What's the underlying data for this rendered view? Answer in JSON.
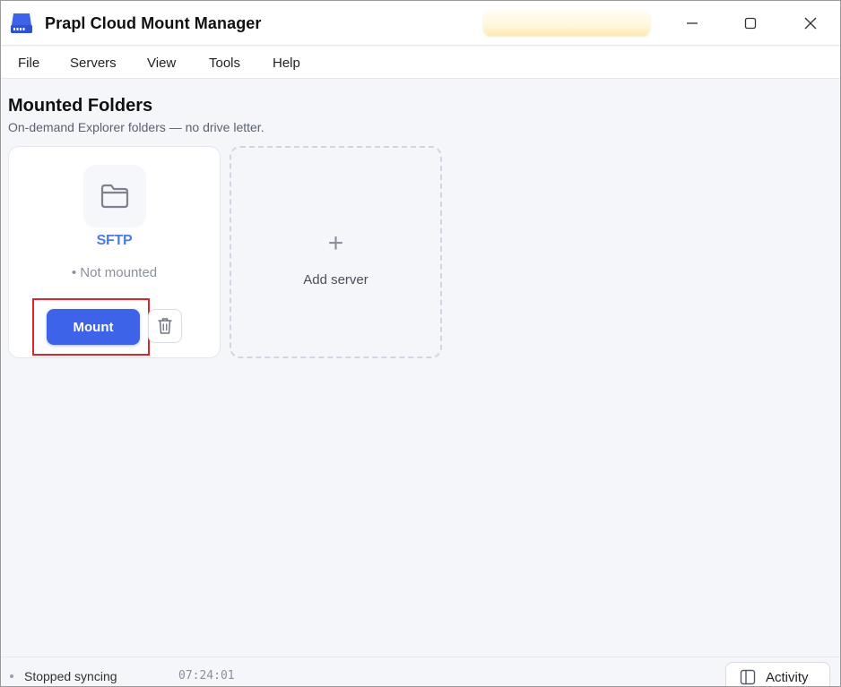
{
  "window": {
    "title": "Prapl Cloud Mount Manager",
    "controls": {
      "minimize": "minimize-icon",
      "maximize": "maximize-icon",
      "close": "close-icon"
    }
  },
  "menu": {
    "items": [
      "File",
      "Servers",
      "View",
      "Tools",
      "Help"
    ]
  },
  "main": {
    "title": "Mounted Folders",
    "subtitle": "On-demand Explorer folders — no drive letter.",
    "server_card": {
      "icon": "folder-icon",
      "name": "SFTP",
      "status": "• Not mounted",
      "mount_label": "Mount",
      "delete_icon": "trash-icon"
    },
    "add_card": {
      "icon": "plus-icon",
      "plus_glyph": "+",
      "label": "Add server"
    }
  },
  "statusbar": {
    "text": "Stopped syncing",
    "time": "07:24:01",
    "activity_label": "Activity",
    "activity_icon": "sidebar-panel-icon"
  },
  "colors": {
    "accent": "#3d63e8",
    "server_name": "#4d7be6",
    "highlight": "#e0242b",
    "background": "#f5f6fa"
  }
}
